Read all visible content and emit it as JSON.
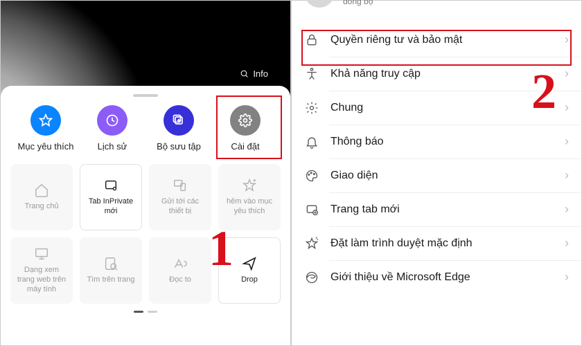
{
  "left": {
    "info_label": "Info",
    "top": [
      {
        "label": "Mục yêu thích",
        "icon": "star-icon",
        "colorClass": "c-blue"
      },
      {
        "label": "Lịch sử",
        "icon": "clock-icon",
        "colorClass": "c-purple"
      },
      {
        "label": "Bộ sưu tập",
        "icon": "collections-icon",
        "colorClass": "c-indigo"
      },
      {
        "label": "Cài đặt",
        "icon": "gear-icon",
        "colorClass": "c-gray"
      }
    ],
    "tiles": [
      {
        "label": "Trang chủ",
        "icon": "home-icon",
        "active": false
      },
      {
        "label": "Tab InPrivate mới",
        "icon": "inprivate-icon",
        "active": true
      },
      {
        "label": "Gửi tới các thiết bị",
        "icon": "send-devices-icon",
        "active": false
      },
      {
        "label": "hêm vào mục yêu thích",
        "icon": "star-plus-icon",
        "active": false
      },
      {
        "label": "Dạng xem trang web trên máy tính",
        "icon": "desktop-icon",
        "active": false
      },
      {
        "label": "Tìm trên trang",
        "icon": "find-icon",
        "active": false
      },
      {
        "label": "Đọc to",
        "icon": "read-aloud-icon",
        "active": false
      },
      {
        "label": "Drop",
        "icon": "drop-icon",
        "active": true
      }
    ],
    "callout": "1"
  },
  "right": {
    "sync_label": "đồng bộ",
    "items": [
      {
        "label": "Quyền riêng tư và bảo mật",
        "icon": "lock-icon"
      },
      {
        "label": "Khả năng truy cập",
        "icon": "accessibility-icon"
      },
      {
        "label": "Chung",
        "icon": "gear-icon"
      },
      {
        "label": "Thông báo",
        "icon": "bell-icon"
      },
      {
        "label": "Giao diện",
        "icon": "palette-icon"
      },
      {
        "label": "Trang tab mới",
        "icon": "newtab-icon"
      },
      {
        "label": "Đặt làm trình duyệt mặc định",
        "icon": "star-shine-icon"
      },
      {
        "label": "Giới thiệu về Microsoft Edge",
        "icon": "edge-icon"
      }
    ],
    "callout": "2"
  }
}
